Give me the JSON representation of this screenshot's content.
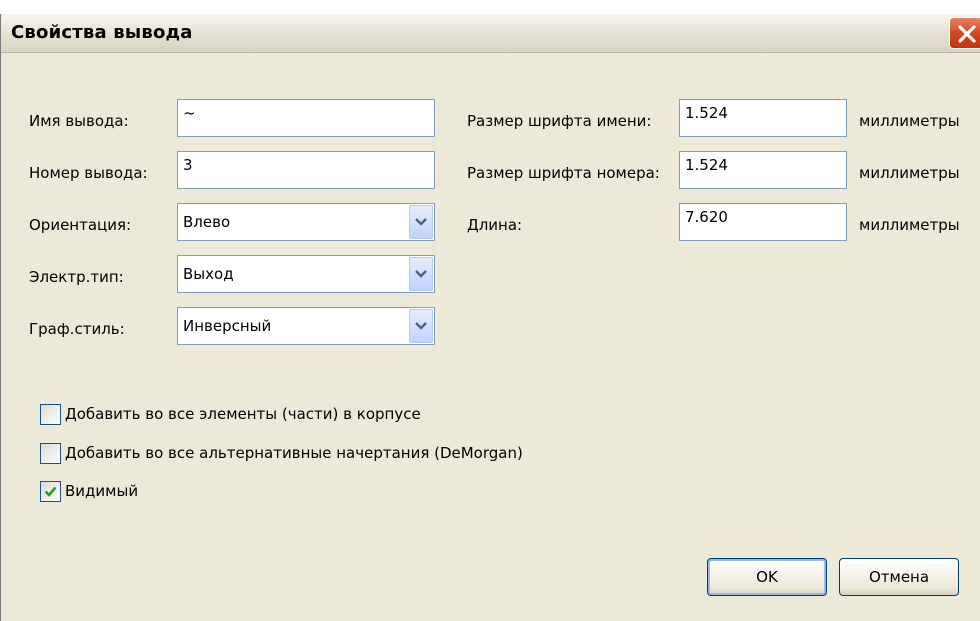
{
  "window": {
    "title": "Свойства вывода"
  },
  "fields": {
    "pin_name": {
      "label": "Имя вывода:",
      "value": "~"
    },
    "pin_number": {
      "label": "Номер вывода:",
      "value": "3"
    },
    "orientation": {
      "label": "Ориентация:",
      "value": "Влево"
    },
    "electrical_type": {
      "label": "Электр.тип:",
      "value": "Выход"
    },
    "graphic_style": {
      "label": "Граф.стиль:",
      "value": "Инверсный"
    },
    "name_font_size": {
      "label": "Размер шрифта имени:",
      "value": "1.524",
      "unit": "миллиметры"
    },
    "number_font_size": {
      "label": "Размер шрифта номера:",
      "value": "1.524",
      "unit": "миллиметры"
    },
    "length": {
      "label": "Длина:",
      "value": "7.620",
      "unit": "миллиметры"
    }
  },
  "checkboxes": [
    {
      "label": "Добавить во все элементы (части) в корпусе",
      "checked": false
    },
    {
      "label": "Добавить во все альтернативные начертания (DeMorgan)",
      "checked": false
    },
    {
      "label": "Видимый",
      "checked": true
    }
  ],
  "buttons": {
    "ok": "OK",
    "cancel": "Отмена"
  },
  "icons": {
    "close": "close-icon",
    "dropdown": "chevron-down-icon",
    "check": "checkmark-icon"
  },
  "colors": {
    "dialog_bg": "#ece9d8",
    "close_red": "#d4471f",
    "field_border": "#7f9db9",
    "check_green": "#21a121"
  }
}
